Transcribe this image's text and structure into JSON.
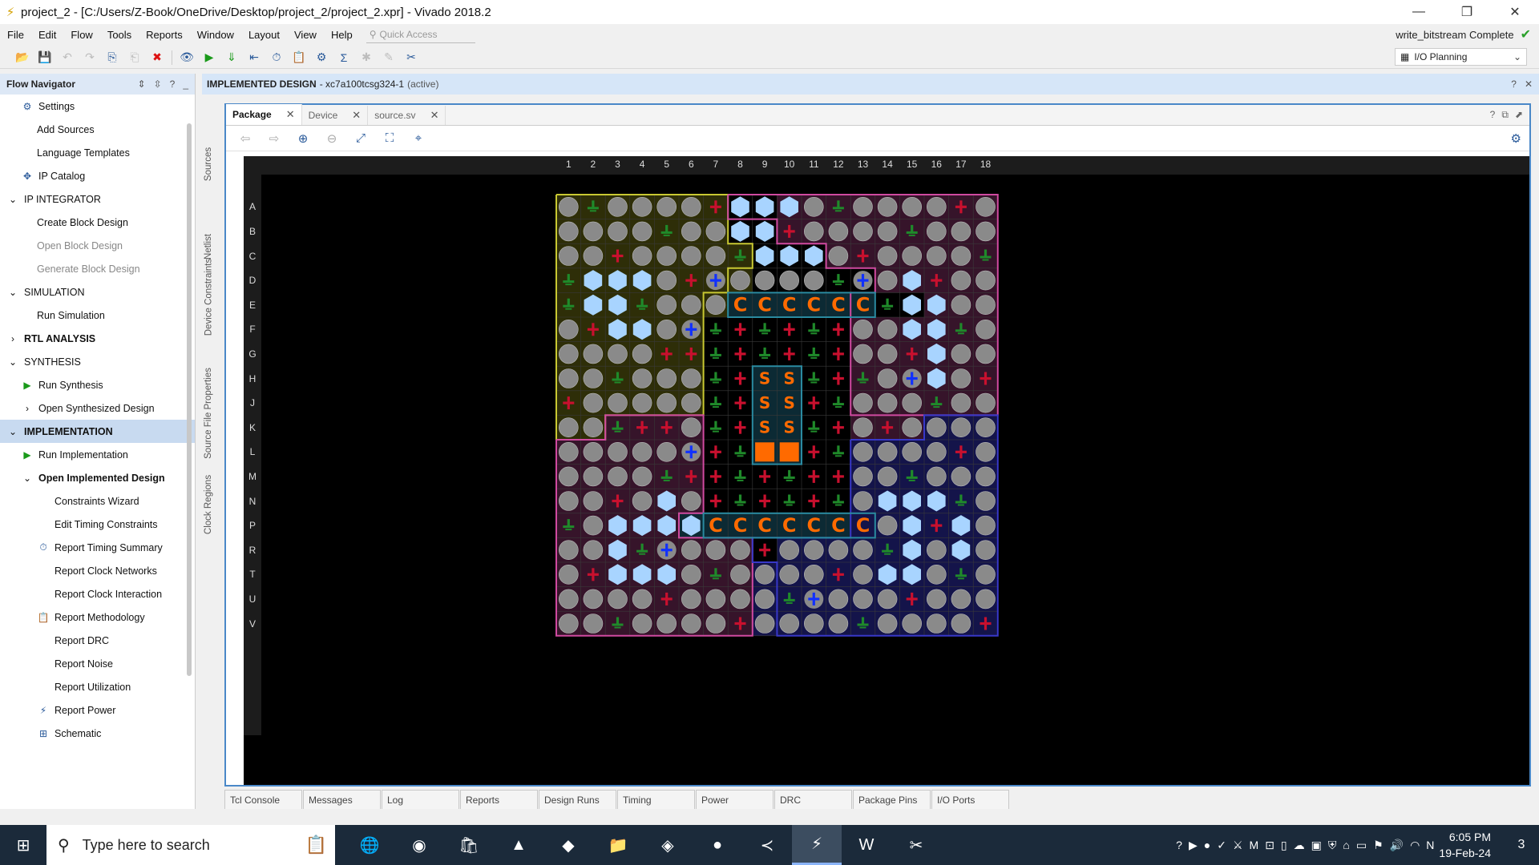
{
  "window": {
    "title": "project_2 - [C:/Users/Z-Book/OneDrive/Desktop/project_2/project_2.xpr] - Vivado 2018.2",
    "minimize": "—",
    "restore": "❐",
    "close": "✕"
  },
  "menu": {
    "items": [
      "File",
      "Edit",
      "Flow",
      "Tools",
      "Reports",
      "Window",
      "Layout",
      "View",
      "Help"
    ],
    "quick_access_placeholder": "Quick Access",
    "status_text": "write_bitstream Complete"
  },
  "toolbar": {
    "layout_select_value": "I/O Planning"
  },
  "flow_navigator": {
    "title": "Flow Navigator",
    "items": [
      {
        "label": "Settings",
        "level": 1,
        "icon": "gear-icon",
        "glyph": "⚙"
      },
      {
        "label": "Add Sources",
        "level": 2
      },
      {
        "label": "Language Templates",
        "level": 2
      },
      {
        "label": "IP Catalog",
        "level": 1,
        "icon": "ip-catalog-icon",
        "glyph": "✥"
      },
      {
        "label": "IP INTEGRATOR",
        "level": 0,
        "section": true,
        "expanded": true
      },
      {
        "label": "Create Block Design",
        "level": 2
      },
      {
        "label": "Open Block Design",
        "level": 2,
        "disabled": true
      },
      {
        "label": "Generate Block Design",
        "level": 2,
        "disabled": true
      },
      {
        "label": "SIMULATION",
        "level": 0,
        "section": true,
        "expanded": true
      },
      {
        "label": "Run Simulation",
        "level": 2
      },
      {
        "label": "RTL ANALYSIS",
        "level": 0,
        "section": true,
        "expanded": false,
        "bold": true
      },
      {
        "label": "SYNTHESIS",
        "level": 0,
        "section": true,
        "expanded": true
      },
      {
        "label": "Run Synthesis",
        "level": 1,
        "icon": "run-icon",
        "glyph": "▶"
      },
      {
        "label": "Open Synthesized Design",
        "level": 1,
        "expander": "›"
      },
      {
        "label": "IMPLEMENTATION",
        "level": 0,
        "section": true,
        "expanded": true,
        "selected": true
      },
      {
        "label": "Run Implementation",
        "level": 1,
        "icon": "run-icon",
        "glyph": "▶"
      },
      {
        "label": "Open Implemented Design",
        "level": 1,
        "expander": "⌄",
        "bold": true
      },
      {
        "label": "Constraints Wizard",
        "level": 3
      },
      {
        "label": "Edit Timing Constraints",
        "level": 3
      },
      {
        "label": "Report Timing Summary",
        "level": 2,
        "icon": "clock-icon",
        "glyph": "⏱"
      },
      {
        "label": "Report Clock Networks",
        "level": 3
      },
      {
        "label": "Report Clock Interaction",
        "level": 3
      },
      {
        "label": "Report Methodology",
        "level": 2,
        "icon": "clipboard-icon",
        "glyph": "📋"
      },
      {
        "label": "Report DRC",
        "level": 3
      },
      {
        "label": "Report Noise",
        "level": 3
      },
      {
        "label": "Report Utilization",
        "level": 3
      },
      {
        "label": "Report Power",
        "level": 2,
        "icon": "power-icon",
        "glyph": "⚡"
      },
      {
        "label": "Schematic",
        "level": 2,
        "icon": "schematic-icon",
        "glyph": "⊞"
      }
    ]
  },
  "side_tabs": [
    "Sources",
    "Netlist",
    "Device Constraints",
    "Source File Properties",
    "Clock Regions"
  ],
  "implemented_design": {
    "label": "IMPLEMENTED DESIGN",
    "part": "- xc7a100tcsg324-1",
    "state": "(active)"
  },
  "package_view": {
    "tabs": [
      {
        "label": "Package",
        "active": true
      },
      {
        "label": "Device",
        "active": false
      },
      {
        "label": "source.sv",
        "active": false
      }
    ],
    "columns": [
      "1",
      "2",
      "3",
      "4",
      "5",
      "6",
      "7",
      "8",
      "9",
      "10",
      "11",
      "12",
      "13",
      "14",
      "15",
      "16",
      "17",
      "18"
    ],
    "rows": [
      "A",
      "B",
      "C",
      "D",
      "E",
      "F",
      "G",
      "H",
      "J",
      "K",
      "L",
      "M",
      "N",
      "P",
      "R",
      "T",
      "U",
      "V"
    ],
    "grid": [
      "OgOOOOrHHHOgOOOOrO",
      "OOOOgOOHHrOOOOgOOO",
      "OOrOOOOgHHHOrOOOOg",
      "gHHHOrbOOOOgbOHrOO",
      "gHHgOOOCCCCCCgHHOO",
      "OrHHObgrgrgrOOHHgO",
      "OOOOrrgrgrgrOOrHOO",
      "OOgOOOgrSSgrgObHOr",
      "rOOOOOgrSSrgOOOgOO",
      "OOgrrOgrSSgrOrOOOO",
      "OOOOObrgQQrgOOOOrO",
      "OOOOgrrgrgrrOOgOOO",
      "OOrOHOrgrgrgOHHHgO",
      "gOHHHHCCCCCCCOHrHO",
      "OOHgbOOOrOOOOgHOHO",
      "OrHHHOgOOOOrOHHOgO",
      "OOOOrOOOOgbOOOrOOO",
      "OOgOOOOrOOOOgOOOOr"
    ]
  },
  "bottom_tabs": [
    "Tcl Console",
    "Messages",
    "Log",
    "Reports",
    "Design Runs",
    "Timing",
    "Power",
    "DRC",
    "Package Pins",
    "I/O Ports"
  ],
  "taskbar": {
    "search_placeholder": "Type here to search",
    "time": "6:05 PM",
    "date": "19-Feb-24",
    "notification_count": "3"
  },
  "colors": {
    "io_pin": "#8a8a8a",
    "config_hex": "#a8d4ff",
    "power_plus": "#c8102e",
    "ground_minus": "#1f8a2a",
    "clock_pin": "#1030ff",
    "assigned_orange": "#ff6a00",
    "bank_yellow": "#c8c832",
    "bank_pink": "#d04aa0",
    "bank_blue": "#3838c8",
    "bank_teal": "#2a8aa0"
  }
}
